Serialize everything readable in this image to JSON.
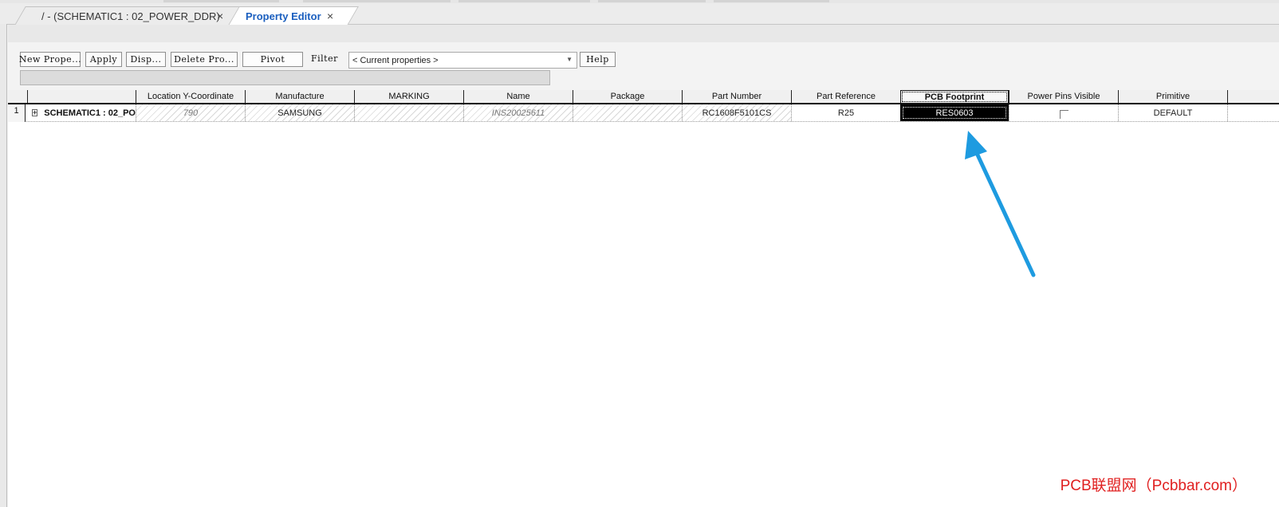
{
  "tabs": [
    {
      "label": "/ - (SCHEMATIC1 : 02_POWER_DDR)",
      "close": "×",
      "active": false
    },
    {
      "label": "Property Editor",
      "close": "×",
      "active": true
    }
  ],
  "toolbar": {
    "new_property": "New Prope...",
    "apply": "Apply",
    "display": "Disp...",
    "delete_property": "Delete Pro...",
    "pivot": "Pivot",
    "filter_label": "Filter",
    "filter_value": "< Current properties >",
    "help": "Help"
  },
  "grid": {
    "columns": [
      "",
      "Location Y-Coordinate",
      "Manufacture",
      "MARKING",
      "Name",
      "Package",
      "Part Number",
      "Part Reference",
      "PCB Footprint",
      "Power Pins Visible",
      "Primitive"
    ],
    "active_column": "PCB Footprint",
    "rows": [
      {
        "row_number": "1",
        "expander": "+",
        "cells": [
          "SCHEMATIC1 : 02_PO",
          "790",
          "SAMSUNG",
          "",
          "INS20025611",
          "",
          "RC1608F5101CS",
          "R25",
          "RES0603",
          "",
          "DEFAULT"
        ],
        "power_pins_visible": false
      }
    ]
  },
  "watermark": "PCB联盟网（Pcbbar.com）",
  "colors": {
    "tab_active_text": "#1b5fbf",
    "arrow": "#1e9be0",
    "watermark": "#e02020",
    "selected_cell_bg": "#000000"
  }
}
